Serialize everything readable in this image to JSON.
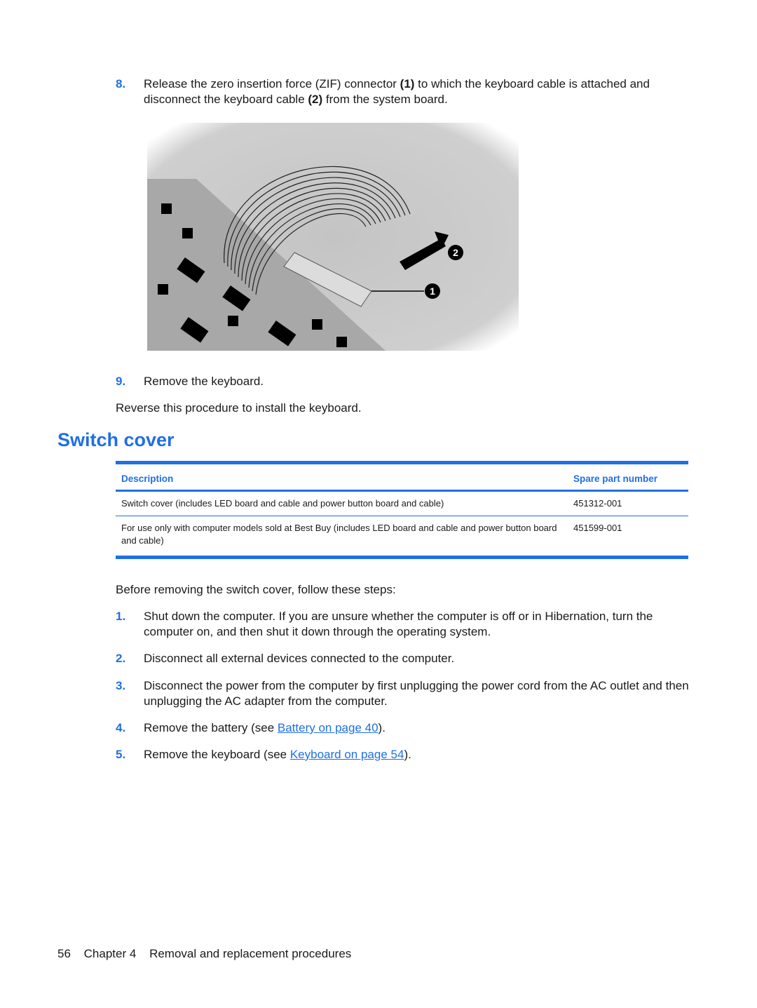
{
  "steps_top": [
    {
      "num": "8.",
      "parts": [
        "Release the zero insertion force (ZIF) connector ",
        "(1)",
        " to which the keyboard cable is attached and disconnect the keyboard cable ",
        "(2)",
        " from the system board."
      ]
    },
    {
      "num": "9.",
      "text": "Remove the keyboard."
    }
  ],
  "figure": {
    "callouts": [
      "1",
      "2"
    ],
    "description": "Keyboard ribbon cable disconnected from ZIF connector on system board"
  },
  "reverse_note": "Reverse this procedure to install the keyboard.",
  "section_title": "Switch cover",
  "table": {
    "headers": [
      "Description",
      "Spare part number"
    ],
    "rows": [
      {
        "description": "Switch cover (includes LED board and cable and power button board and cable)",
        "part": "451312-001"
      },
      {
        "description": "For use only with computer models sold at Best Buy (includes LED board and cable and power button board and cable)",
        "part": "451599-001"
      }
    ]
  },
  "intro": "Before removing the switch cover, follow these steps:",
  "steps": [
    {
      "num": "1.",
      "text": "Shut down the computer. If you are unsure whether the computer is off or in Hibernation, turn the computer on, and then shut it down through the operating system."
    },
    {
      "num": "2.",
      "text": "Disconnect all external devices connected to the computer."
    },
    {
      "num": "3.",
      "text": "Disconnect the power from the computer by first unplugging the power cord from the AC outlet and then unplugging the AC adapter from the computer."
    },
    {
      "num": "4.",
      "pre": "Remove the battery (see ",
      "link": "Battery on page 40",
      "post": ")."
    },
    {
      "num": "5.",
      "pre": "Remove the keyboard (see ",
      "link": "Keyboard on page 54",
      "post": ")."
    }
  ],
  "footer": {
    "page": "56",
    "chapter": "Chapter 4",
    "title": "Removal and replacement procedures"
  },
  "colors": {
    "accent": "#1f6fe5",
    "text": "#1a1a1a"
  }
}
